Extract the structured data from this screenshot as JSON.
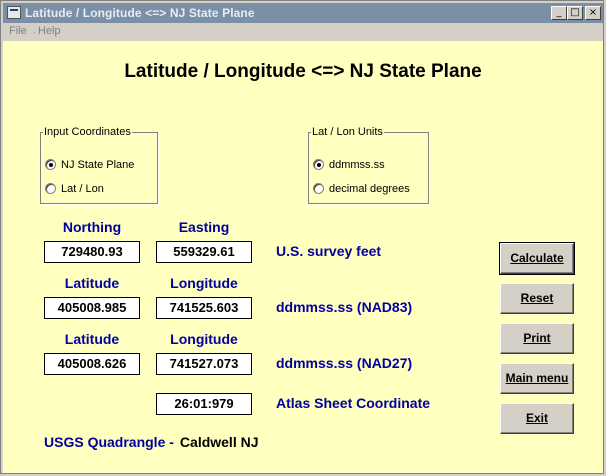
{
  "window": {
    "title": "Latitude / Longitude <=> NJ State Plane",
    "minimize_glyph": "_",
    "maximize_glyph": "□",
    "close_glyph": "×"
  },
  "menu": {
    "file": "File",
    "help": "Help"
  },
  "heading": "Latitude / Longitude <=> NJ State Plane",
  "input_group": {
    "legend": "Input Coordinates",
    "options": [
      {
        "label": "NJ State Plane",
        "selected": true
      },
      {
        "label": "Lat / Lon",
        "selected": false
      }
    ]
  },
  "units_group": {
    "legend": "Lat / Lon Units",
    "options": [
      {
        "label": "ddmmss.ss",
        "selected": true
      },
      {
        "label": "decimal degrees",
        "selected": false
      }
    ]
  },
  "rows": [
    {
      "col1_header": "Northing",
      "col2_header": "Easting",
      "col1_value": "729480.93",
      "col2_value": "559329.61",
      "unit": "U.S. survey feet"
    },
    {
      "col1_header": "Latitude",
      "col2_header": "Longitude",
      "col1_value": "405008.985",
      "col2_value": "741525.603",
      "unit": "ddmmss.ss (NAD83)"
    },
    {
      "col1_header": "Latitude",
      "col2_header": "Longitude",
      "col1_value": "405008.626",
      "col2_value": "741527.073",
      "unit": "ddmmss.ss (NAD27)"
    }
  ],
  "atlas": {
    "value": "26:01:979",
    "label": "Atlas Sheet Coordinate"
  },
  "quadrangle": {
    "label": "USGS Quadrangle -",
    "value": "Caldwell NJ"
  },
  "buttons": {
    "calculate": "Calculate",
    "reset": "Reset",
    "print": "Print",
    "main_menu": "Main menu",
    "exit": "Exit"
  },
  "colors": {
    "titlebar": "#7b8fa6",
    "client_bg": "#ffffc0",
    "accent_text": "#0000a0"
  }
}
